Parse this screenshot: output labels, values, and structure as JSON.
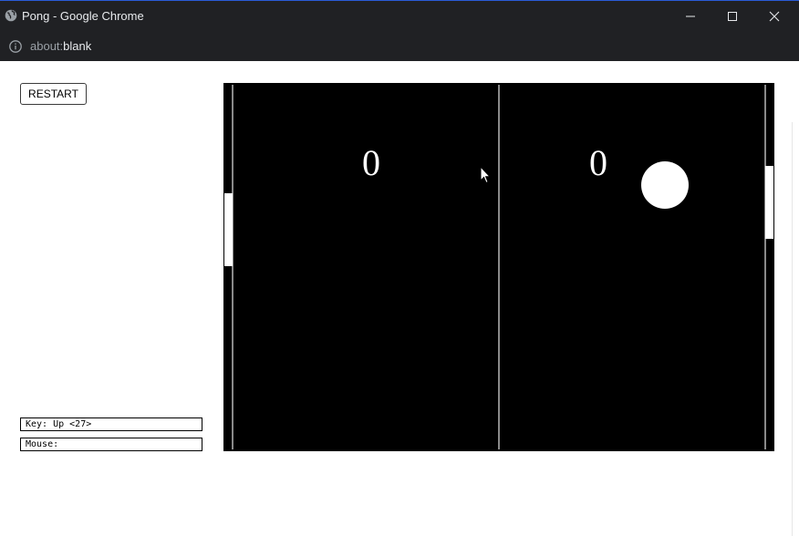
{
  "window": {
    "title": "Pong - Google Chrome"
  },
  "address_bar": {
    "url_scheme": "about:",
    "url_host": "blank"
  },
  "controls": {
    "restart_label": "RESTART"
  },
  "readouts": {
    "key": "Key: Up <27>",
    "mouse": "Mouse:"
  },
  "game": {
    "score_left": "0",
    "score_right": "0",
    "court_color": "#000000",
    "line_color": "#8a8a8a"
  },
  "icons": {
    "title": "globe-icon",
    "address": "info-icon",
    "window_controls": [
      "minimize-icon",
      "maximize-icon",
      "close-icon"
    ],
    "pointer": "mouse-cursor-icon"
  }
}
